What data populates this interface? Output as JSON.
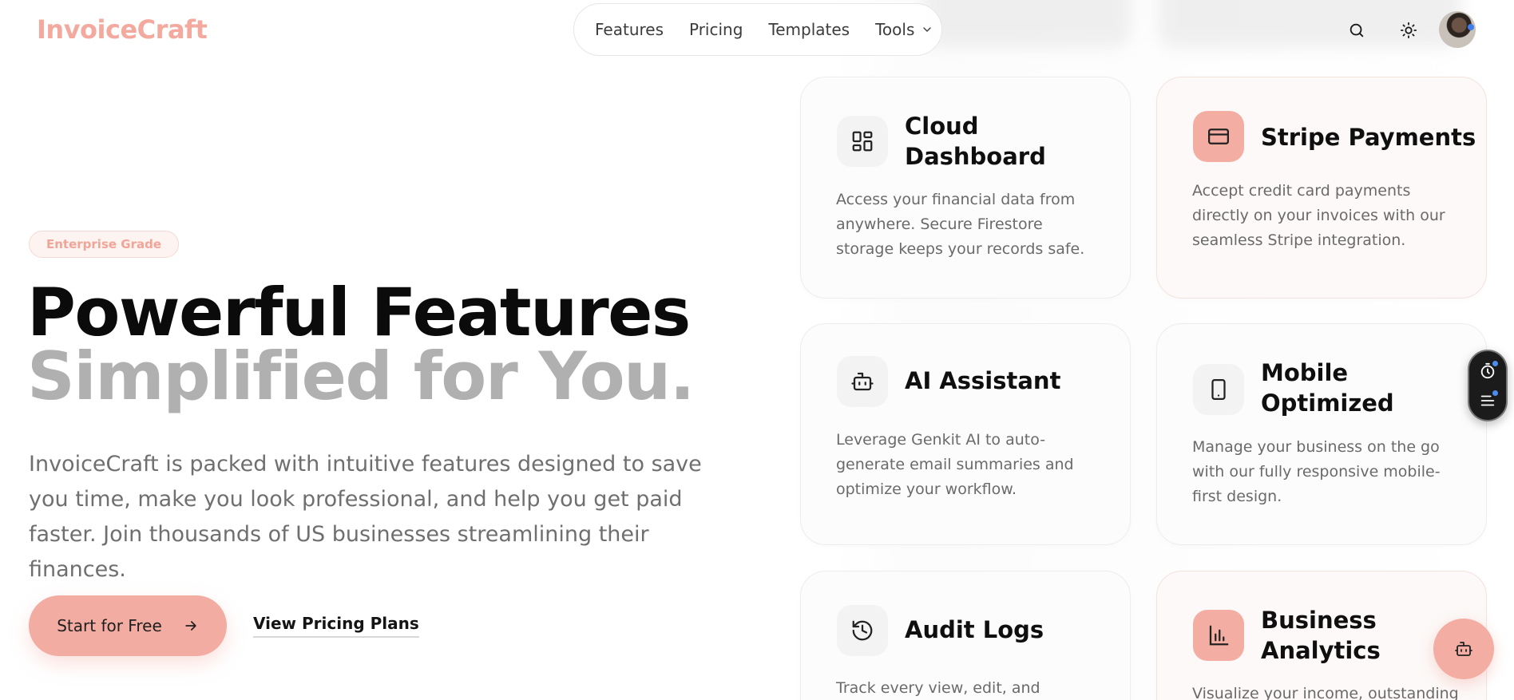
{
  "brand": {
    "name": "InvoiceCraft",
    "accent": "#f3aca1"
  },
  "nav": {
    "items": [
      {
        "label": "Features"
      },
      {
        "label": "Pricing"
      },
      {
        "label": "Templates"
      },
      {
        "label": "Tools",
        "icon": "chevron-down-icon"
      }
    ]
  },
  "header_icons": [
    "search-icon",
    "sun-icon",
    "avatar"
  ],
  "hero": {
    "badge": "Enterprise Grade",
    "title_line1": "Powerful Features",
    "title_line2": "Simplified for You.",
    "description": "InvoiceCraft is packed with intuitive features designed to save you time, make you look professional, and help you get paid faster. Join thousands of US businesses streamlining their finances.",
    "primary_cta": "Start for Free",
    "secondary_cta": "View Pricing Plans"
  },
  "features": [
    {
      "title": "Cloud Dashboard",
      "description": "Access your financial data from anywhere. Secure Firestore storage keeps your records safe.",
      "icon": "dashboard-grid-icon"
    },
    {
      "title": "Stripe Payments",
      "description": "Accept credit card payments directly on your invoices with our seamless Stripe integration.",
      "icon": "credit-card-icon"
    },
    {
      "title": "AI Assistant",
      "description": "Leverage Genkit AI to auto-generate email summaries and optimize your workflow.",
      "icon": "bot-icon"
    },
    {
      "title": "Mobile Optimized",
      "description": "Manage your business on the go with our fully responsive mobile-first design.",
      "icon": "smartphone-icon"
    },
    {
      "title": "Audit Logs",
      "description": "Track every view, edit, and",
      "icon": "history-icon"
    },
    {
      "title": "Business Analytics",
      "description": "Visualize your income, outstanding",
      "icon": "bar-chart-icon"
    }
  ],
  "floating": {
    "side_widget_icons": [
      "timer-icon",
      "list-icon"
    ],
    "fab_icon": "bot-icon"
  }
}
